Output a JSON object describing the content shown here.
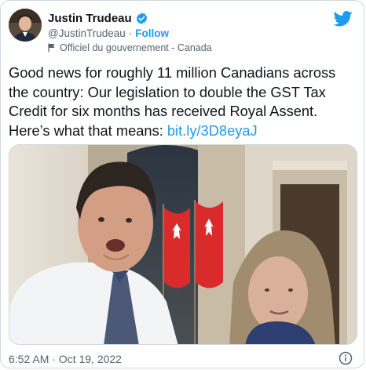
{
  "author": {
    "display_name": "Justin Trudeau",
    "handle": "@JustinTrudeau",
    "separator": "·",
    "follow_label": "Follow",
    "label": "Officiel du gouvernement - Canada"
  },
  "tweet": {
    "text": "Good news for roughly 11 million Canadians across the country: Our legislation to double the GST Tax Credit for six months has received Royal Assent. Here’s what that means: ",
    "link": "bit.ly/3D8eyaJ"
  },
  "meta": {
    "timestamp": "6:52 AM · Oct 19, 2022"
  },
  "colors": {
    "accent": "#1d9bf0",
    "verified": "#1d9bf0",
    "text": "#0f1419",
    "muted": "#536471"
  },
  "icons": {
    "verified": "verified-badge-icon",
    "brand": "twitter-bird-icon",
    "label": "flag-icon",
    "info": "info-icon"
  }
}
